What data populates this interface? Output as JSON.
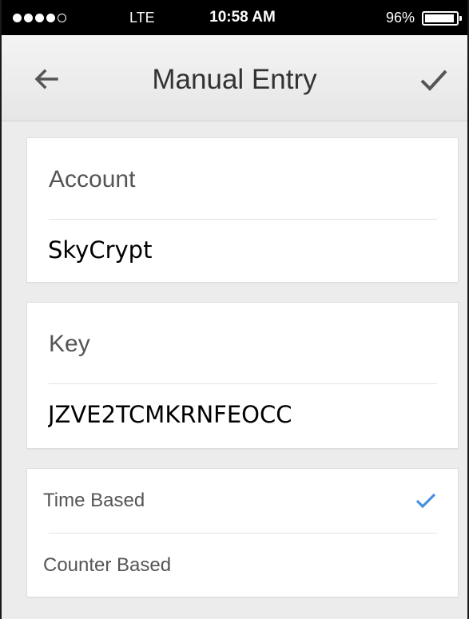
{
  "status_bar": {
    "carrier": "LTE",
    "time": "10:58 AM",
    "battery_percent": "96%",
    "battery_level": 0.96,
    "signal_bars_filled": 4,
    "signal_bars_total": 5
  },
  "nav": {
    "title": "Manual Entry",
    "back_icon": "arrow-left-icon",
    "confirm_icon": "checkmark-icon"
  },
  "form": {
    "account": {
      "label": "Account",
      "value": "SkyCrypt"
    },
    "key": {
      "label": "Key",
      "value": "JZVE2TCMKRNFEOCC"
    },
    "type_options": [
      {
        "label": "Time Based",
        "selected": true
      },
      {
        "label": "Counter Based",
        "selected": false
      }
    ]
  },
  "colors": {
    "accent": "#4a90e2",
    "nav_icon": "#555555",
    "background": "#ececec"
  }
}
